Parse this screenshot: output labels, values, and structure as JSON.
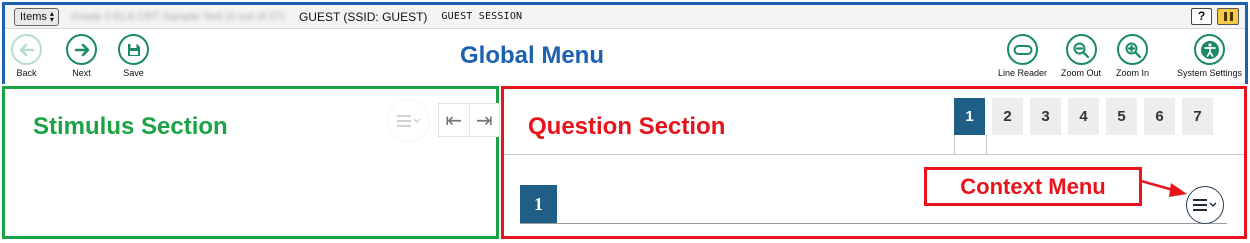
{
  "topbar": {
    "items_label": "Items",
    "test_name": "Grade 3 ELA CRT Sample Test (0 out of 27)",
    "guest_name": "GUEST (SSID: GUEST)",
    "session": "GUEST SESSION",
    "help_label": "?"
  },
  "global_menu": {
    "title": "Global Menu",
    "left_tools": [
      {
        "label": "Back",
        "icon": "arrow-left-icon",
        "enabled": false
      },
      {
        "label": "Next",
        "icon": "arrow-right-icon",
        "enabled": true
      },
      {
        "label": "Save",
        "icon": "save-icon",
        "enabled": true
      }
    ],
    "right_tools": [
      {
        "label": "Line Reader",
        "icon": "line-reader-icon"
      },
      {
        "label": "Zoom Out",
        "icon": "zoom-out-icon"
      },
      {
        "label": "Zoom In",
        "icon": "zoom-in-icon"
      },
      {
        "label": "System Settings",
        "icon": "accessibility-icon"
      }
    ]
  },
  "stimulus": {
    "title": "Stimulus Section"
  },
  "question": {
    "title": "Question Section",
    "tabs": [
      "1",
      "2",
      "3",
      "4",
      "5",
      "6",
      "7"
    ],
    "active_tab": "1",
    "number": "1"
  },
  "context_menu": {
    "label": "Context Menu"
  },
  "colors": {
    "global": "#1d62b0",
    "stimulus": "#1ba345",
    "question": "#e8141b",
    "tool_green": "#1a8a61",
    "tab_active": "#1f5f86"
  }
}
